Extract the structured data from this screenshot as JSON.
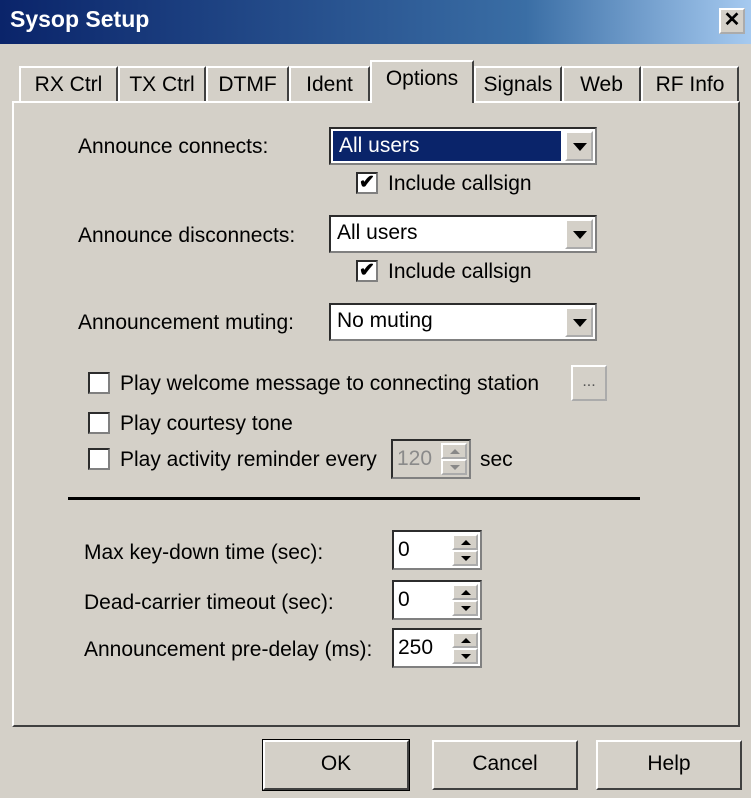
{
  "window": {
    "title": "Sysop Setup",
    "close_glyph": "✕"
  },
  "tabs": [
    {
      "label": "RX Ctrl"
    },
    {
      "label": "TX Ctrl"
    },
    {
      "label": "DTMF"
    },
    {
      "label": "Ident"
    },
    {
      "label": "Options",
      "active": true
    },
    {
      "label": "Signals"
    },
    {
      "label": "Web"
    },
    {
      "label": "RF Info"
    }
  ],
  "options": {
    "announce_connects": {
      "label": "Announce connects:",
      "value": "All users",
      "include_callsign_label": "Include callsign",
      "include_callsign": true
    },
    "announce_disconnects": {
      "label": "Announce disconnects:",
      "value": "All users",
      "include_callsign_label": "Include callsign",
      "include_callsign": true
    },
    "announcement_muting": {
      "label": "Announcement muting:",
      "value": "No muting"
    },
    "welcome": {
      "label": "Play welcome message to connecting station",
      "checked": false,
      "browse_label": "..."
    },
    "courtesy": {
      "label": "Play courtesy tone",
      "checked": false
    },
    "reminder": {
      "label": "Play activity reminder every",
      "checked": false,
      "value": "120",
      "unit": "sec"
    },
    "max_keydown": {
      "label": "Max key-down time (sec):",
      "value": "0"
    },
    "dead_carrier": {
      "label": "Dead-carrier timeout (sec):",
      "value": "0"
    },
    "predelay": {
      "label": "Announcement pre-delay (ms):",
      "value": "250"
    }
  },
  "buttons": {
    "ok": "OK",
    "cancel": "Cancel",
    "help": "Help"
  },
  "colors": {
    "selection": "#0a246a",
    "face": "#d4d0c8"
  }
}
